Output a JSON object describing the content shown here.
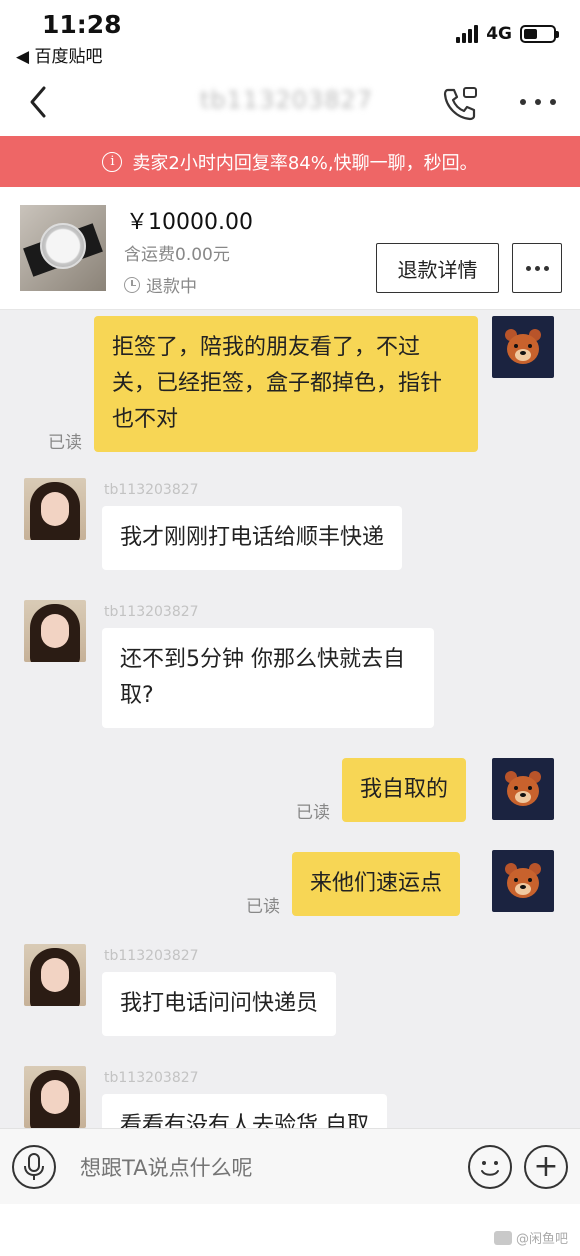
{
  "status": {
    "time": "11:28",
    "back_app": "◀ 百度贴吧",
    "network": "4G"
  },
  "nav": {
    "title": "tb113203827"
  },
  "banner": {
    "text": "卖家2小时内回复率84%,快聊一聊，秒回。"
  },
  "product": {
    "price": "￥10000.00",
    "shipping": "含运费0.00元",
    "status": "退款中",
    "refund_button": "退款详情"
  },
  "messages": [
    {
      "side": "right",
      "text": "拒签了，陪我的朋友看了，不过关，已经拒签，盒子都掉色，指针也不对",
      "read": "已读"
    },
    {
      "side": "left",
      "name": "tb113203827",
      "text": "我才刚刚打电话给顺丰快递"
    },
    {
      "side": "left",
      "name": "tb113203827",
      "text": "还不到5分钟 你那么快就去自取?"
    },
    {
      "side": "right",
      "text": "我自取的",
      "read": "已读"
    },
    {
      "side": "right",
      "text": "来他们速运点",
      "read": "已读"
    },
    {
      "side": "left",
      "name": "tb113203827",
      "text": "我打电话问问快递员"
    },
    {
      "side": "left",
      "name": "tb113203827",
      "text": "看看有没有人去验货 自取"
    }
  ],
  "input": {
    "placeholder": "想跟TA说点什么呢"
  },
  "watermark": "@闲鱼吧"
}
